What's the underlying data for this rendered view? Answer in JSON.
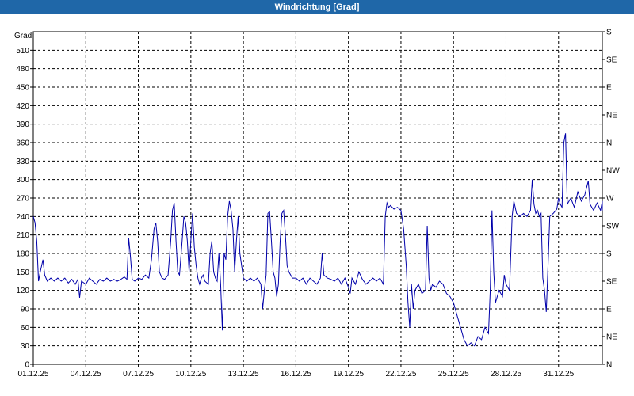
{
  "window": {
    "title": "Windrichtung [Grad]"
  },
  "chart_data": {
    "type": "line",
    "title": "Windrichtung [Grad]",
    "ylabel": "Grad",
    "xlabel": "",
    "ylim": [
      0,
      540
    ],
    "yticks": [
      0,
      30,
      60,
      90,
      120,
      150,
      180,
      210,
      240,
      270,
      300,
      330,
      360,
      390,
      420,
      450,
      480,
      510
    ],
    "right_ticks": [
      "N",
      "NE",
      "E",
      "SE",
      "S",
      "SW",
      "W",
      "NW",
      "N",
      "NE",
      "E",
      "SE",
      "S"
    ],
    "xlim": [
      0,
      32.5
    ],
    "xticks": [
      {
        "day": 0,
        "label": "01.12.25"
      },
      {
        "day": 3,
        "label": "04.12.25"
      },
      {
        "day": 6,
        "label": "07.12.25"
      },
      {
        "day": 9,
        "label": "10.12.25"
      },
      {
        "day": 12,
        "label": "13.12.25"
      },
      {
        "day": 15,
        "label": "16.12.25"
      },
      {
        "day": 18,
        "label": "19.12.25"
      },
      {
        "day": 21,
        "label": "22.12.25"
      },
      {
        "day": 24,
        "label": "25.12.25"
      },
      {
        "day": 27,
        "label": "28.12.25"
      },
      {
        "day": 30,
        "label": "31.12.25"
      }
    ],
    "grid": true,
    "color": "#0000aa",
    "series": [
      {
        "points": [
          [
            0.0,
            240
          ],
          [
            0.1,
            230
          ],
          [
            0.2,
            200
          ],
          [
            0.3,
            135
          ],
          [
            0.4,
            150
          ],
          [
            0.55,
            170
          ],
          [
            0.65,
            145
          ],
          [
            0.8,
            135
          ],
          [
            1.0,
            140
          ],
          [
            1.2,
            135
          ],
          [
            1.4,
            140
          ],
          [
            1.6,
            135
          ],
          [
            1.8,
            140
          ],
          [
            2.0,
            132
          ],
          [
            2.2,
            138
          ],
          [
            2.4,
            130
          ],
          [
            2.55,
            138
          ],
          [
            2.65,
            108
          ],
          [
            2.75,
            135
          ],
          [
            3.0,
            130
          ],
          [
            3.2,
            140
          ],
          [
            3.4,
            135
          ],
          [
            3.6,
            130
          ],
          [
            3.8,
            138
          ],
          [
            4.0,
            135
          ],
          [
            4.2,
            140
          ],
          [
            4.4,
            135
          ],
          [
            4.6,
            138
          ],
          [
            4.8,
            135
          ],
          [
            5.0,
            138
          ],
          [
            5.2,
            142
          ],
          [
            5.35,
            138
          ],
          [
            5.45,
            205
          ],
          [
            5.55,
            175
          ],
          [
            5.65,
            138
          ],
          [
            5.8,
            135
          ],
          [
            6.0,
            140
          ],
          [
            6.2,
            138
          ],
          [
            6.4,
            145
          ],
          [
            6.6,
            140
          ],
          [
            6.75,
            170
          ],
          [
            6.9,
            220
          ],
          [
            7.0,
            230
          ],
          [
            7.1,
            200
          ],
          [
            7.2,
            150
          ],
          [
            7.35,
            140
          ],
          [
            7.5,
            138
          ],
          [
            7.7,
            145
          ],
          [
            7.85,
            200
          ],
          [
            7.95,
            250
          ],
          [
            8.05,
            262
          ],
          [
            8.15,
            200
          ],
          [
            8.25,
            150
          ],
          [
            8.35,
            145
          ],
          [
            8.5,
            200
          ],
          [
            8.6,
            240
          ],
          [
            8.7,
            230
          ],
          [
            8.8,
            200
          ],
          [
            8.9,
            150
          ],
          [
            9.0,
            200
          ],
          [
            9.1,
            245
          ],
          [
            9.2,
            190
          ],
          [
            9.3,
            160
          ],
          [
            9.4,
            140
          ],
          [
            9.5,
            130
          ],
          [
            9.6,
            140
          ],
          [
            9.7,
            145
          ],
          [
            9.8,
            135
          ],
          [
            10.0,
            130
          ],
          [
            10.1,
            180
          ],
          [
            10.2,
            200
          ],
          [
            10.3,
            150
          ],
          [
            10.4,
            140
          ],
          [
            10.5,
            135
          ],
          [
            10.6,
            180
          ],
          [
            10.7,
            130
          ],
          [
            10.8,
            55
          ],
          [
            10.9,
            180
          ],
          [
            11.0,
            170
          ],
          [
            11.1,
            240
          ],
          [
            11.2,
            265
          ],
          [
            11.3,
            250
          ],
          [
            11.4,
            220
          ],
          [
            11.5,
            150
          ],
          [
            11.6,
            200
          ],
          [
            11.7,
            240
          ],
          [
            11.8,
            180
          ],
          [
            11.9,
            160
          ],
          [
            12.0,
            140
          ],
          [
            12.2,
            135
          ],
          [
            12.4,
            140
          ],
          [
            12.6,
            135
          ],
          [
            12.8,
            140
          ],
          [
            13.0,
            130
          ],
          [
            13.1,
            90
          ],
          [
            13.2,
            120
          ],
          [
            13.3,
            145
          ],
          [
            13.4,
            245
          ],
          [
            13.5,
            248
          ],
          [
            13.6,
            200
          ],
          [
            13.7,
            150
          ],
          [
            13.8,
            140
          ],
          [
            13.9,
            110
          ],
          [
            14.0,
            130
          ],
          [
            14.1,
            200
          ],
          [
            14.2,
            245
          ],
          [
            14.3,
            250
          ],
          [
            14.4,
            210
          ],
          [
            14.5,
            160
          ],
          [
            14.6,
            150
          ],
          [
            14.8,
            140
          ],
          [
            15.0,
            140
          ],
          [
            15.2,
            135
          ],
          [
            15.4,
            140
          ],
          [
            15.6,
            130
          ],
          [
            15.8,
            140
          ],
          [
            16.0,
            135
          ],
          [
            16.2,
            130
          ],
          [
            16.4,
            140
          ],
          [
            16.5,
            180
          ],
          [
            16.6,
            145
          ],
          [
            16.8,
            140
          ],
          [
            17.0,
            138
          ],
          [
            17.2,
            135
          ],
          [
            17.4,
            140
          ],
          [
            17.6,
            130
          ],
          [
            17.8,
            140
          ],
          [
            18.0,
            125
          ],
          [
            18.1,
            115
          ],
          [
            18.2,
            140
          ],
          [
            18.4,
            130
          ],
          [
            18.6,
            150
          ],
          [
            18.8,
            138
          ],
          [
            19.0,
            130
          ],
          [
            19.2,
            135
          ],
          [
            19.4,
            140
          ],
          [
            19.6,
            135
          ],
          [
            19.8,
            140
          ],
          [
            20.0,
            130
          ],
          [
            20.1,
            240
          ],
          [
            20.2,
            262
          ],
          [
            20.3,
            255
          ],
          [
            20.4,
            258
          ],
          [
            20.6,
            252
          ],
          [
            20.8,
            255
          ],
          [
            21.0,
            250
          ],
          [
            21.15,
            220
          ],
          [
            21.3,
            160
          ],
          [
            21.4,
            100
          ],
          [
            21.5,
            60
          ],
          [
            21.6,
            130
          ],
          [
            21.7,
            90
          ],
          [
            21.8,
            120
          ],
          [
            22.0,
            130
          ],
          [
            22.2,
            115
          ],
          [
            22.4,
            120
          ],
          [
            22.5,
            225
          ],
          [
            22.6,
            140
          ],
          [
            22.7,
            120
          ],
          [
            22.8,
            130
          ],
          [
            23.0,
            125
          ],
          [
            23.2,
            135
          ],
          [
            23.4,
            130
          ],
          [
            23.6,
            115
          ],
          [
            23.8,
            110
          ],
          [
            24.0,
            100
          ],
          [
            24.2,
            80
          ],
          [
            24.4,
            60
          ],
          [
            24.6,
            40
          ],
          [
            24.8,
            30
          ],
          [
            25.0,
            35
          ],
          [
            25.2,
            30
          ],
          [
            25.4,
            45
          ],
          [
            25.6,
            40
          ],
          [
            25.8,
            60
          ],
          [
            26.0,
            50
          ],
          [
            26.1,
            120
          ],
          [
            26.2,
            250
          ],
          [
            26.3,
            150
          ],
          [
            26.4,
            100
          ],
          [
            26.6,
            120
          ],
          [
            26.8,
            110
          ],
          [
            26.9,
            145
          ],
          [
            27.0,
            130
          ],
          [
            27.2,
            120
          ],
          [
            27.35,
            240
          ],
          [
            27.45,
            265
          ],
          [
            27.6,
            245
          ],
          [
            27.8,
            240
          ],
          [
            28.0,
            245
          ],
          [
            28.2,
            240
          ],
          [
            28.4,
            250
          ],
          [
            28.5,
            300
          ],
          [
            28.6,
            260
          ],
          [
            28.7,
            245
          ],
          [
            28.8,
            250
          ],
          [
            28.9,
            240
          ],
          [
            29.0,
            245
          ],
          [
            29.1,
            140
          ],
          [
            29.2,
            120
          ],
          [
            29.3,
            85
          ],
          [
            29.4,
            160
          ],
          [
            29.5,
            240
          ],
          [
            29.7,
            245
          ],
          [
            29.9,
            252
          ],
          [
            30.0,
            270
          ],
          [
            30.1,
            260
          ],
          [
            30.2,
            255
          ],
          [
            30.3,
            360
          ],
          [
            30.4,
            375
          ],
          [
            30.5,
            260
          ],
          [
            30.7,
            270
          ],
          [
            30.9,
            255
          ],
          [
            31.1,
            280
          ],
          [
            31.3,
            265
          ],
          [
            31.5,
            275
          ],
          [
            31.7,
            298
          ],
          [
            31.8,
            260
          ],
          [
            32.0,
            250
          ],
          [
            32.2,
            262
          ],
          [
            32.4,
            250
          ],
          [
            32.6,
            265
          ],
          [
            32.8,
            262
          ],
          [
            33.0,
            255
          ],
          [
            33.2,
            250
          ],
          [
            33.4,
            255
          ]
        ]
      }
    ]
  }
}
